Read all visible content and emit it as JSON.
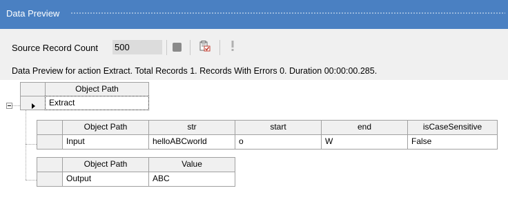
{
  "panel": {
    "title": "Data Preview"
  },
  "toolbar": {
    "source_label": "Source Record Count",
    "source_value": "500",
    "stop_icon": "stop-icon",
    "preview_icon": "clipboard-check-icon",
    "warning_icon": "exclamation-icon"
  },
  "status": {
    "message": "Data Preview for action Extract. Total Records 1. Records With Errors 0. Duration 00:00:00.285."
  },
  "grid": {
    "root_header": "Object Path",
    "root_row": "Extract",
    "child_table_1": {
      "headers": [
        "Object Path",
        "str",
        "start",
        "end",
        "isCaseSensitive"
      ],
      "row": [
        "Input",
        "helloABCworld",
        "o",
        "W",
        "False"
      ]
    },
    "child_table_2": {
      "headers": [
        "Object Path",
        "Value"
      ],
      "row": [
        "Output",
        "ABC"
      ]
    }
  },
  "colors": {
    "title_bar": "#4a80c2",
    "toolbar_bg": "#f0f0f0",
    "grid_border": "#a0a0a0"
  }
}
